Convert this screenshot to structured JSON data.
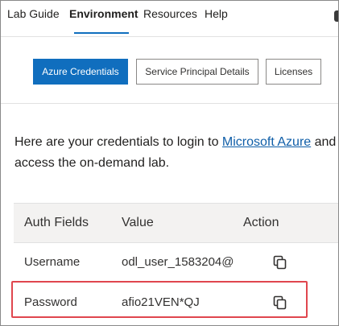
{
  "nav": {
    "tabs": [
      {
        "label": "Lab Guide"
      },
      {
        "label": "Environment",
        "active": true
      },
      {
        "label": "Resources"
      },
      {
        "label": "Help"
      }
    ],
    "accent_color": "#106ebe"
  },
  "subtabs": {
    "azure_credentials": "Azure Credentials",
    "service_principal": "Service Principal Details",
    "licenses": "Licenses"
  },
  "intro": {
    "text_before": "Here are your credentials to login to ",
    "link_text": "Microsoft Azure",
    "text_after_line1": " and",
    "line2": "access the on-demand lab."
  },
  "table": {
    "headers": {
      "field": "Auth Fields",
      "value": "Value",
      "action": "Action"
    },
    "rows": [
      {
        "field": "Username",
        "value": "odl_user_1583204@",
        "action_icon": "copy-icon"
      },
      {
        "field": "Password",
        "value": "afio21VEN*QJ",
        "action_icon": "copy-icon"
      }
    ]
  },
  "highlight_color": "#e0464e"
}
